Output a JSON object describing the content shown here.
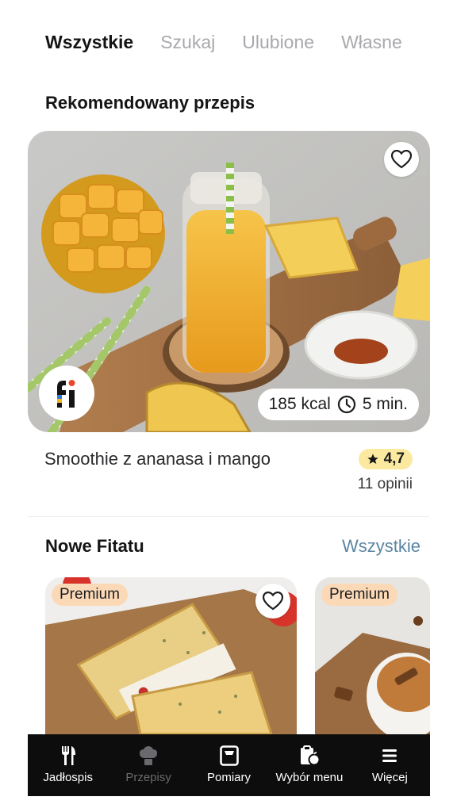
{
  "tabs": [
    {
      "label": "Wszystkie",
      "active": true
    },
    {
      "label": "Szukaj",
      "active": false
    },
    {
      "label": "Ulubione",
      "active": false
    },
    {
      "label": "Własne",
      "active": false
    }
  ],
  "recommended": {
    "section_title": "Rekomendowany przepis",
    "recipe_name": "Smoothie z ananasa i mango",
    "kcal": "185 kcal",
    "time": "5 min.",
    "rating": "4,7",
    "reviews": "11 opinii",
    "logo_text": "fi"
  },
  "new_section": {
    "title": "Nowe Fitatu",
    "see_all": "Wszystkie",
    "cards": [
      {
        "badge": "Premium"
      },
      {
        "badge": "Premium"
      }
    ]
  },
  "nav": [
    {
      "label": "Jadłospis",
      "icon": "cutlery-icon",
      "active": true
    },
    {
      "label": "Przepisy",
      "icon": "chef-hat-icon",
      "active": false
    },
    {
      "label": "Pomiary",
      "icon": "scale-icon",
      "active": true
    },
    {
      "label": "Wybór menu",
      "icon": "clipboard-apple-icon",
      "active": true
    },
    {
      "label": "Więcej",
      "icon": "menu-icon",
      "active": true
    }
  ],
  "colors": {
    "accent_link": "#5a86a3",
    "rating_bg": "#fbe9a0",
    "premium_bg": "#fbd9b6",
    "nav_bg": "#0d0d0d"
  }
}
